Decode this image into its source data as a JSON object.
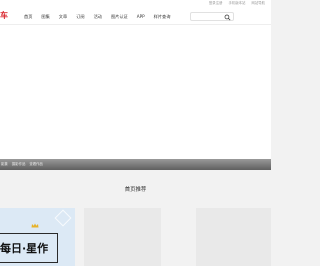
{
  "top_links": [
    "登录注册",
    "手机版本站",
    "网站导航"
  ],
  "logo": "车",
  "nav": {
    "items": [
      "首页",
      "图集",
      "文章",
      "订阅",
      "活动",
      "图片认证",
      "APP",
      "样片查询"
    ],
    "active": "首页"
  },
  "search": {
    "value": "",
    "placeholder": ""
  },
  "breadcrumbs": [
    "影集",
    "摄影作品",
    "查看作品"
  ],
  "section": {
    "title": "首页推荐"
  },
  "cards": {
    "first": {
      "art_text": "每日·星作",
      "accent_color": "#e7b32a"
    }
  },
  "colors": {
    "brand": "#d9272e"
  }
}
